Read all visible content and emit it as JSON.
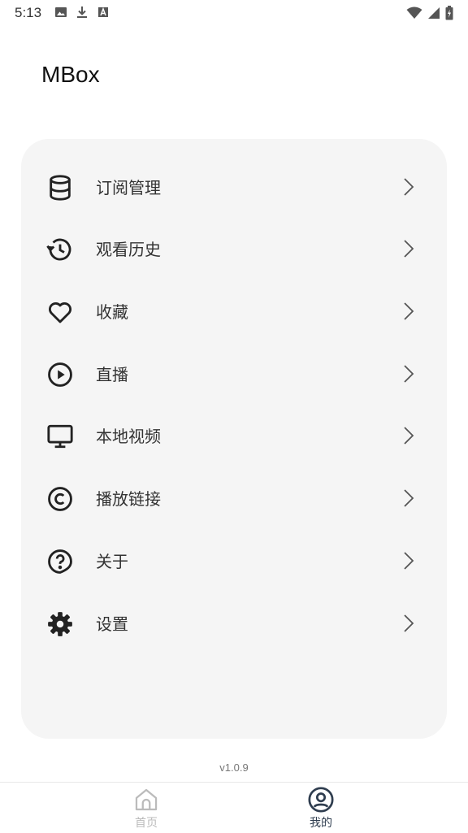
{
  "status_bar": {
    "time": "5:13",
    "left_icons": [
      "image-icon",
      "download-icon",
      "text-a-icon"
    ],
    "right_icons": [
      "wifi-icon",
      "signal-icon",
      "battery-icon"
    ]
  },
  "header": {
    "title": "MBox"
  },
  "menu": {
    "items": [
      {
        "label": "订阅管理",
        "icon": "database-icon"
      },
      {
        "label": "观看历史",
        "icon": "history-icon"
      },
      {
        "label": "收藏",
        "icon": "heart-icon"
      },
      {
        "label": "直播",
        "icon": "play-circle-icon"
      },
      {
        "label": "本地视频",
        "icon": "monitor-icon"
      },
      {
        "label": "播放链接",
        "icon": "copyright-icon"
      },
      {
        "label": "关于",
        "icon": "help-circle-icon"
      },
      {
        "label": "设置",
        "icon": "gear-icon"
      }
    ]
  },
  "footer": {
    "version": "v1.0.9"
  },
  "bottom_nav": {
    "tabs": [
      {
        "label": "首页",
        "icon": "home-icon",
        "active": false
      },
      {
        "label": "我的",
        "icon": "user-circle-icon",
        "active": true
      }
    ],
    "active_color": "#2f3d4f",
    "inactive_color": "#bbbbbb"
  }
}
